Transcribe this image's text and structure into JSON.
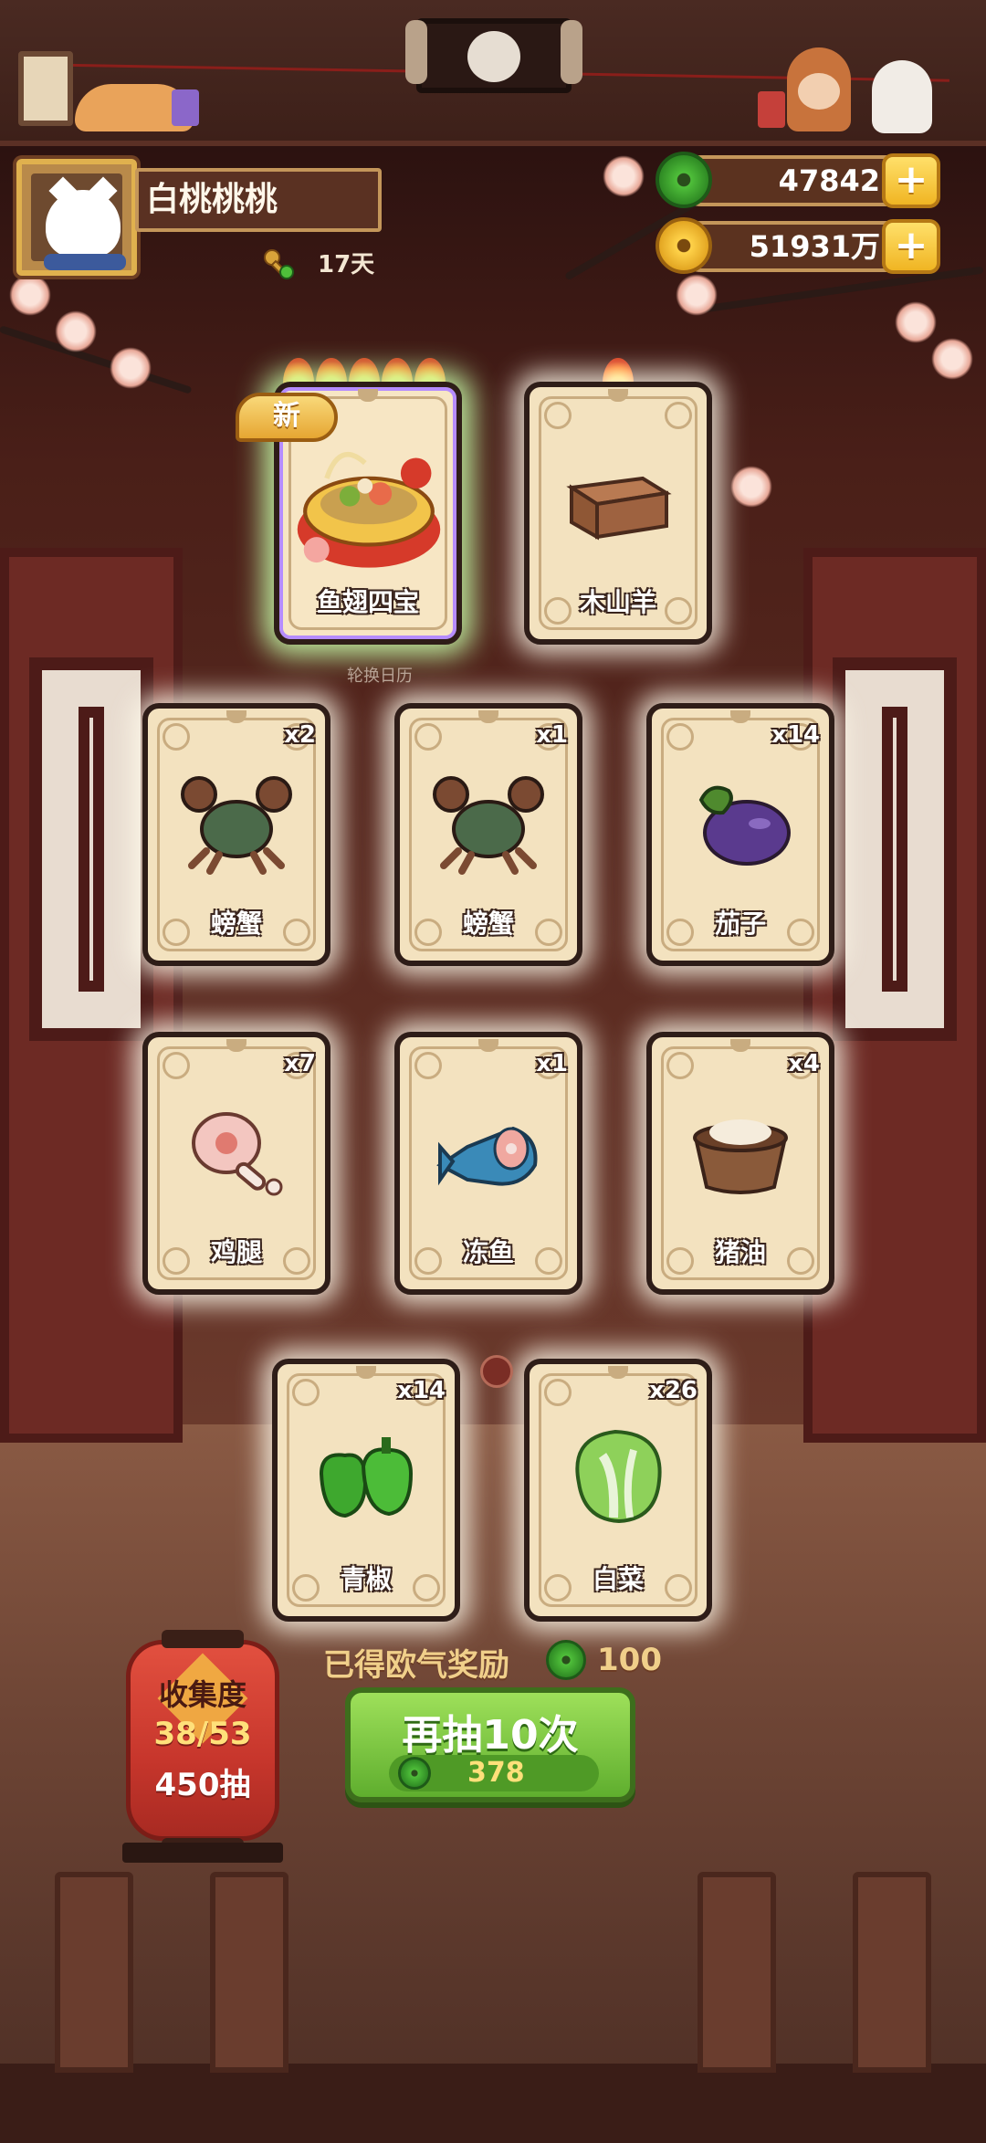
{
  "player": {
    "name": "白桃桃桃",
    "days": "17天"
  },
  "currency": {
    "jade": "47842",
    "gold": "51931万"
  },
  "featured_cards": [
    {
      "name": "鱼翅四宝",
      "flames": 5,
      "is_new": true,
      "new_label": "新"
    },
    {
      "name": "木山羊",
      "flames": 1,
      "is_new": false
    }
  ],
  "calendar_label": "轮换日历",
  "cards": [
    {
      "name": "螃蟹",
      "count": "x2",
      "icon": "crab-icon"
    },
    {
      "name": "螃蟹",
      "count": "x1",
      "icon": "crab-icon"
    },
    {
      "name": "茄子",
      "count": "x14",
      "icon": "eggplant-icon"
    },
    {
      "name": "鸡腿",
      "count": "x7",
      "icon": "chicken-leg-icon"
    },
    {
      "name": "冻鱼",
      "count": "x1",
      "icon": "frozen-fish-icon"
    },
    {
      "name": "猪油",
      "count": "x4",
      "icon": "lard-icon"
    },
    {
      "name": "青椒",
      "count": "x14",
      "icon": "green-pepper-icon"
    },
    {
      "name": "白菜",
      "count": "x26",
      "icon": "cabbage-icon"
    }
  ],
  "reward": {
    "label": "已得欧气奖励",
    "value": "100"
  },
  "draw_button": {
    "label": "再抽10次",
    "cost": "378"
  },
  "collection": {
    "label": "收集度",
    "progress": "38/53",
    "draws": "450抽"
  },
  "colors": {
    "jade": "#3fa52e",
    "gold": "#f0b523",
    "button_green": "#7cc443",
    "card_bg": "#f3e2bf"
  }
}
